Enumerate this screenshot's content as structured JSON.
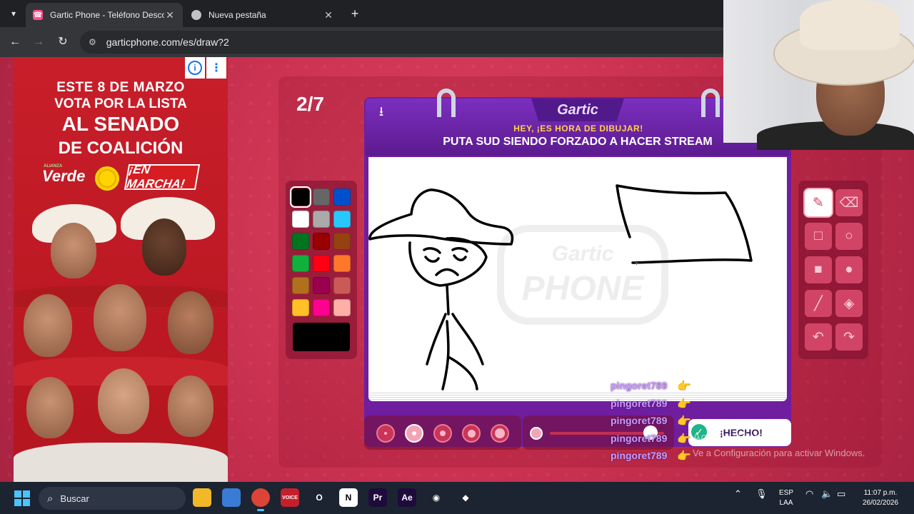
{
  "browser": {
    "tabs": [
      {
        "title": "Gartic Phone - Teléfono Descon",
        "active": true
      },
      {
        "title": "Nueva pestaña",
        "active": false
      }
    ],
    "url": "garticphone.com/es/draw?2"
  },
  "ad": {
    "line1": "ESTE 8 DE MARZO",
    "line2": "VOTA POR LA LISTA",
    "line3": "AL SENADO",
    "line4": "DE COALICIÓN",
    "party_small": "ALIANZA",
    "party": "Verde",
    "slogan": "¡EN MARCHA!",
    "info_icon": "i",
    "more_icon": "⋮"
  },
  "game": {
    "round": "2/7",
    "logo": "Gartic",
    "hey": "HEY, ¡ES HORA DE DIBUJAR!",
    "prompt": "PUTA SUD SIENDO FORZADO A HACER STREAM",
    "watermark_line1": "Gartic",
    "watermark_line2": "PHONE",
    "done_label": "¡HECHO!",
    "palette": [
      "#000000",
      "#666666",
      "#0050cd",
      "#ffffff",
      "#aaaaaa",
      "#26c9ff",
      "#017420",
      "#990000",
      "#964112",
      "#11b03c",
      "#ff0013",
      "#ff7829",
      "#b0701c",
      "#99004e",
      "#cb5a57",
      "#ffc126",
      "#ff008f",
      "#feafa8"
    ],
    "current_color": "#000000",
    "tools": [
      {
        "name": "pen-tool-icon",
        "glyph": "✎",
        "active": true
      },
      {
        "name": "eraser-tool-icon",
        "glyph": "⌫",
        "active": false
      },
      {
        "name": "rectangle-outline-tool-icon",
        "glyph": "□",
        "active": false
      },
      {
        "name": "ellipse-outline-tool-icon",
        "glyph": "○",
        "active": false
      },
      {
        "name": "rectangle-filled-tool-icon",
        "glyph": "■",
        "active": false
      },
      {
        "name": "ellipse-filled-tool-icon",
        "glyph": "●",
        "active": false
      },
      {
        "name": "line-tool-icon",
        "glyph": "╱",
        "active": false
      },
      {
        "name": "fill-bucket-tool-icon",
        "glyph": "◈",
        "active": false
      },
      {
        "name": "undo-tool-icon",
        "glyph": "↶",
        "active": false
      },
      {
        "name": "redo-tool-icon",
        "glyph": "↷",
        "active": false
      }
    ],
    "brush_sizes_selected": 2,
    "opacity_value": 0.88
  },
  "chat": [
    "pingoret789",
    "pingoret789",
    "pingoret789",
    "pingoret789",
    "pingoret789"
  ],
  "watermark": {
    "title": "Activar Windows",
    "subtitle": "Ve a Configuración para activar Windows."
  },
  "taskbar": {
    "search_placeholder": "Buscar",
    "lang_line1": "ESP",
    "lang_line2": "LAA",
    "time": "11:07 p.m.",
    "date": "26/02/2026",
    "apps": [
      {
        "name": "file-explorer-icon",
        "label": "",
        "bg": "#f3b829"
      },
      {
        "name": "store-icon",
        "label": "",
        "bg": "#3a7bd5"
      },
      {
        "name": "chrome-icon",
        "label": "",
        "bg": "#db4437"
      },
      {
        "name": "voicemeeter-icon",
        "label": "VOICE",
        "bg": "#c41f2c"
      },
      {
        "name": "opera-icon",
        "label": "O",
        "bg": "#1c2331"
      },
      {
        "name": "notion-icon",
        "label": "N",
        "bg": "#ffffff"
      },
      {
        "name": "premiere-icon",
        "label": "Pr",
        "bg": "#1f0a3c"
      },
      {
        "name": "after-effects-icon",
        "label": "Ae",
        "bg": "#1f0a3c"
      },
      {
        "name": "obs-icon",
        "label": "◉",
        "bg": "#1c2331"
      },
      {
        "name": "app-icon",
        "label": "◆",
        "bg": "#1c2331"
      }
    ]
  }
}
